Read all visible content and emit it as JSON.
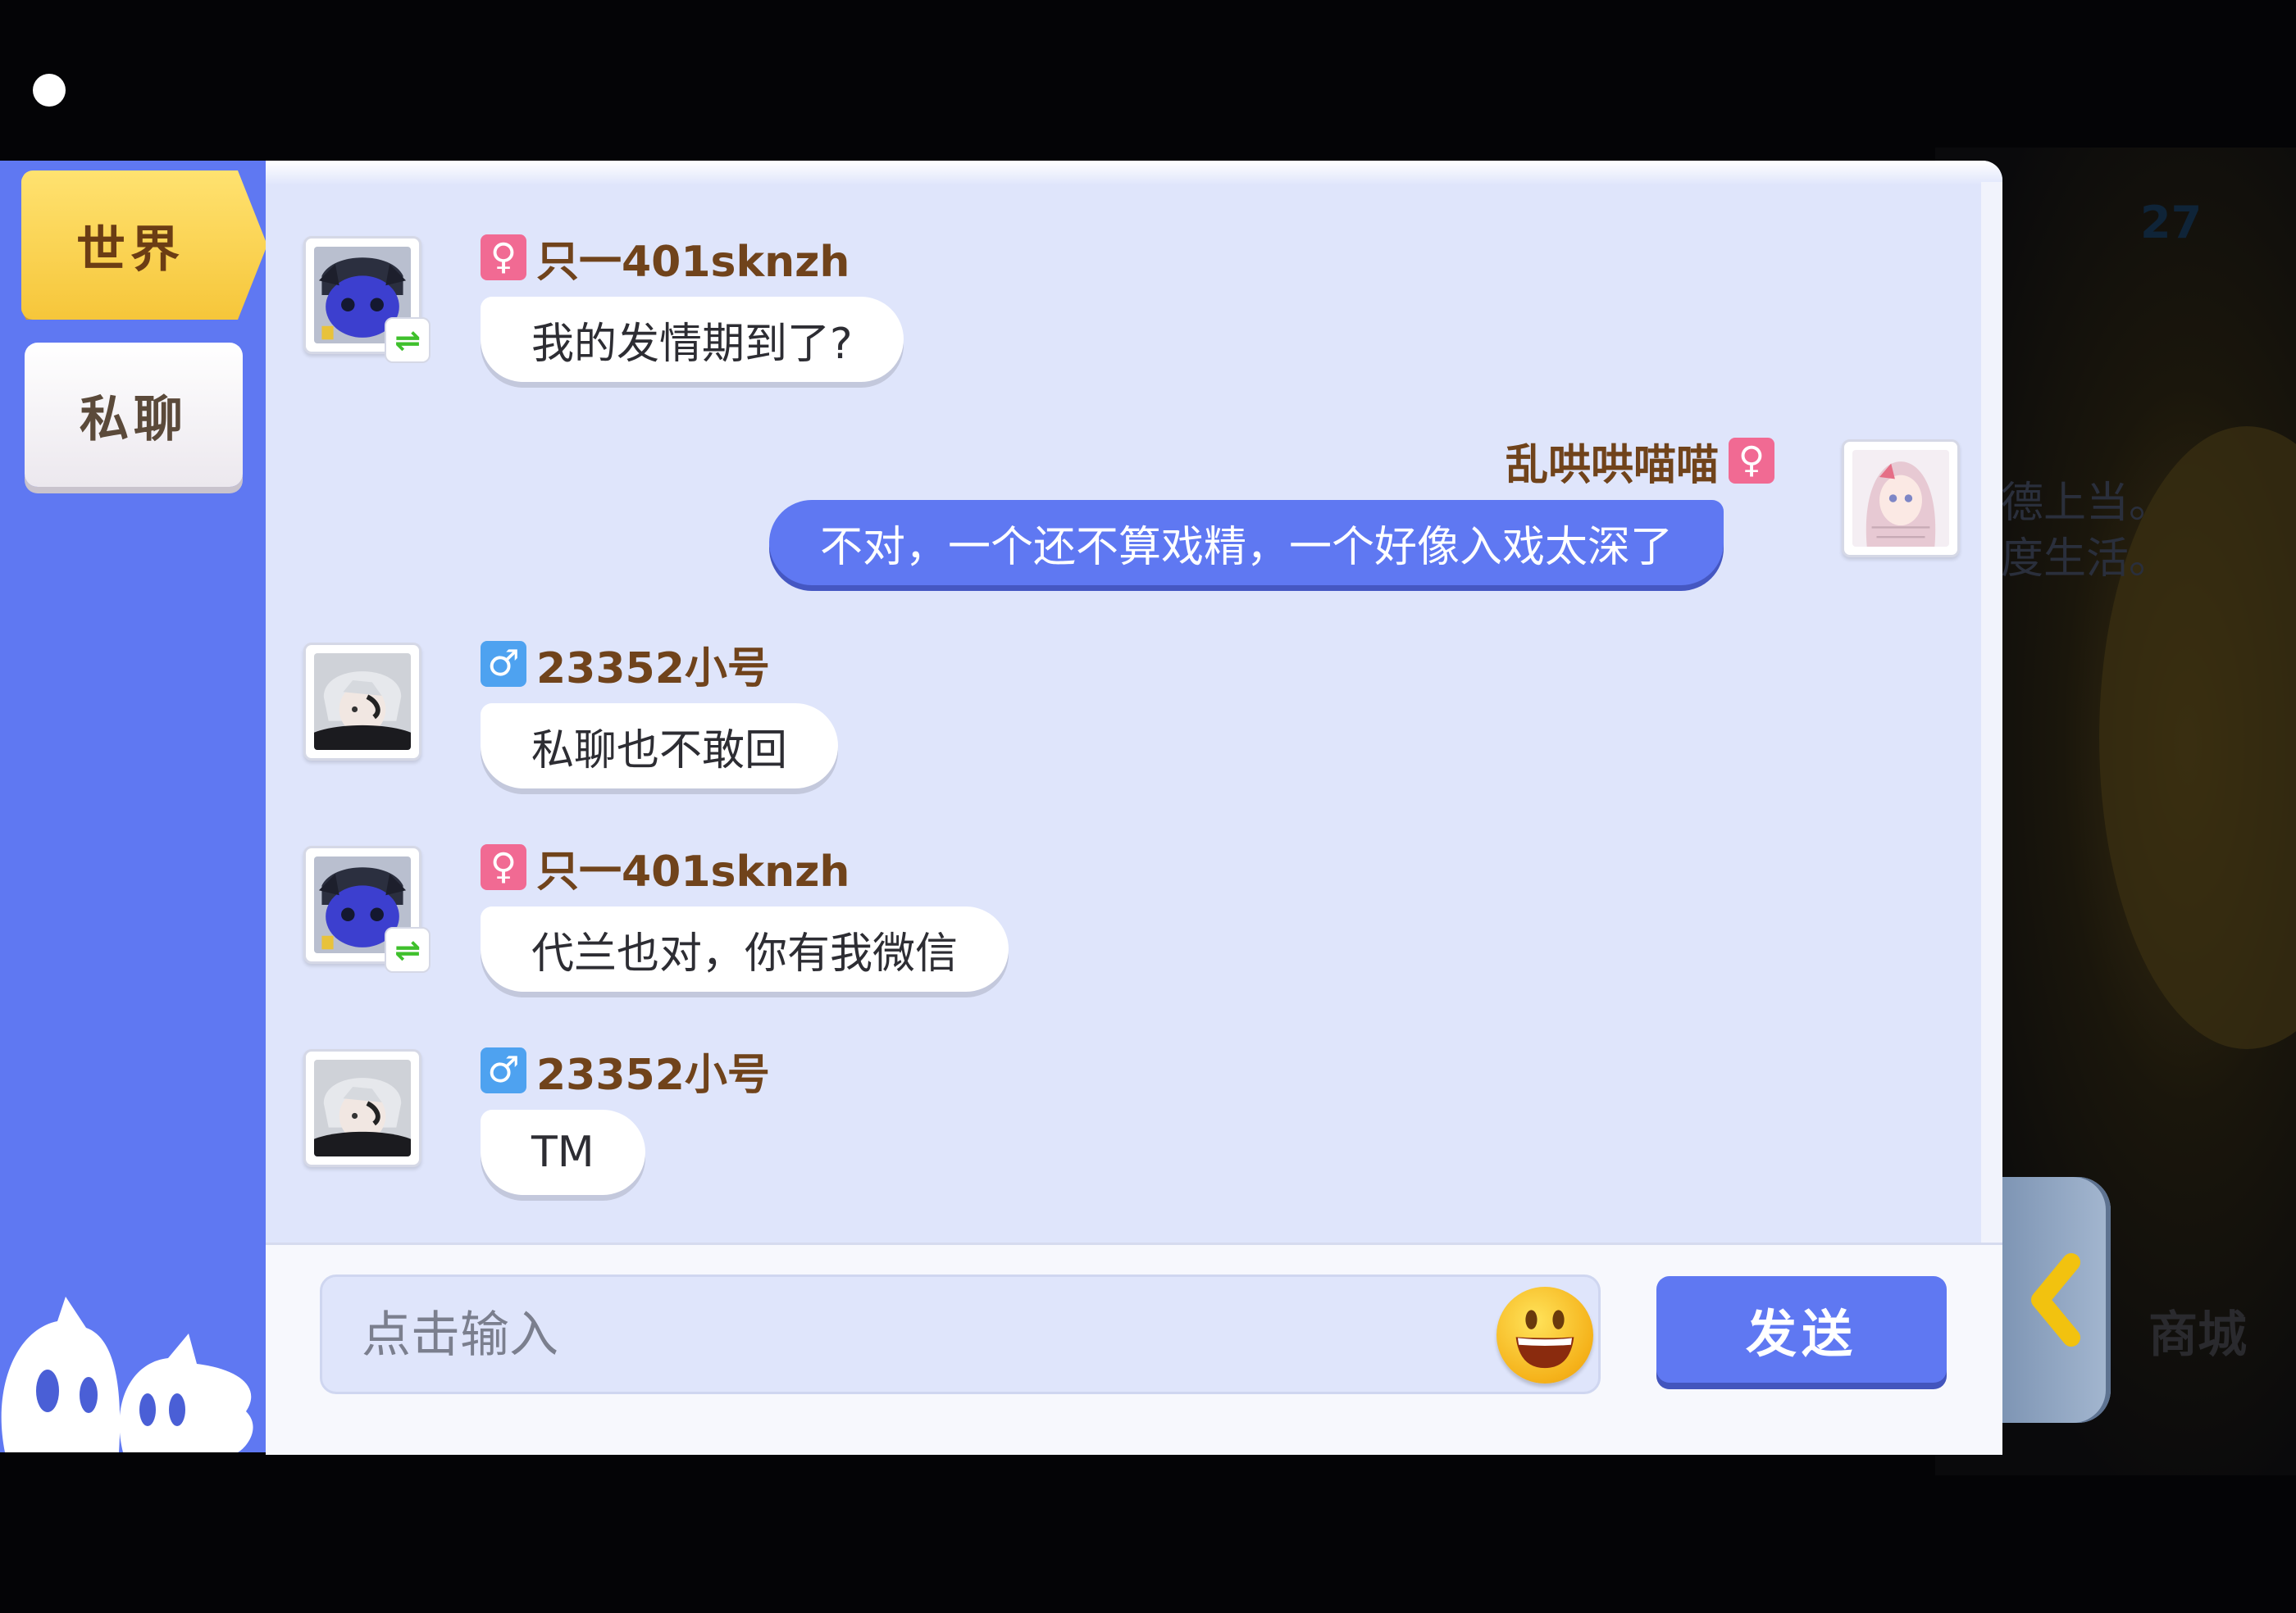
{
  "sidebar": {
    "tabs": [
      {
        "label": "世界",
        "active": true
      },
      {
        "label": "私聊",
        "active": false
      }
    ]
  },
  "background": {
    "counter": "27",
    "caption_lines": [
      "德上当。",
      "度生活。"
    ],
    "shop_label": "商城"
  },
  "messages": [
    {
      "side": "left",
      "username": "只一401sknzh",
      "gender": "female",
      "gender_symbol": "♀",
      "avatar": "blue-horned-avatar",
      "badge": "swap-badge",
      "text": "我的发情期到了?"
    },
    {
      "side": "right",
      "username": "乱哄哄喵喵",
      "gender": "female",
      "gender_symbol": "♀",
      "avatar": "anime-girl-avatar",
      "text": "不对，一个还不算戏精，一个好像入戏太深了"
    },
    {
      "side": "left",
      "username": "23352小号",
      "gender": "male",
      "gender_symbol": "♂",
      "avatar": "silver-hair-avatar",
      "text": "私聊也不敢回"
    },
    {
      "side": "left",
      "username": "只一401sknzh",
      "gender": "female",
      "gender_symbol": "♀",
      "avatar": "blue-horned-avatar",
      "badge": "swap-badge",
      "text": "代兰也对，你有我微信"
    },
    {
      "side": "left",
      "username": "23352小号",
      "gender": "male",
      "gender_symbol": "♂",
      "avatar": "silver-hair-avatar",
      "text": "TM"
    }
  ],
  "input": {
    "placeholder": "点击输入",
    "value": "",
    "emoji_icon": "smiley-emoji-icon",
    "send_label": "发送"
  },
  "colors": {
    "sidebar": "#5f78f2",
    "chat_bg": "#dfe5fb",
    "tab_active": "#f6c63a",
    "bubble_out": "#5f78f2",
    "username": "#70431b",
    "female": "#f16a93",
    "male": "#4ea2f0"
  }
}
